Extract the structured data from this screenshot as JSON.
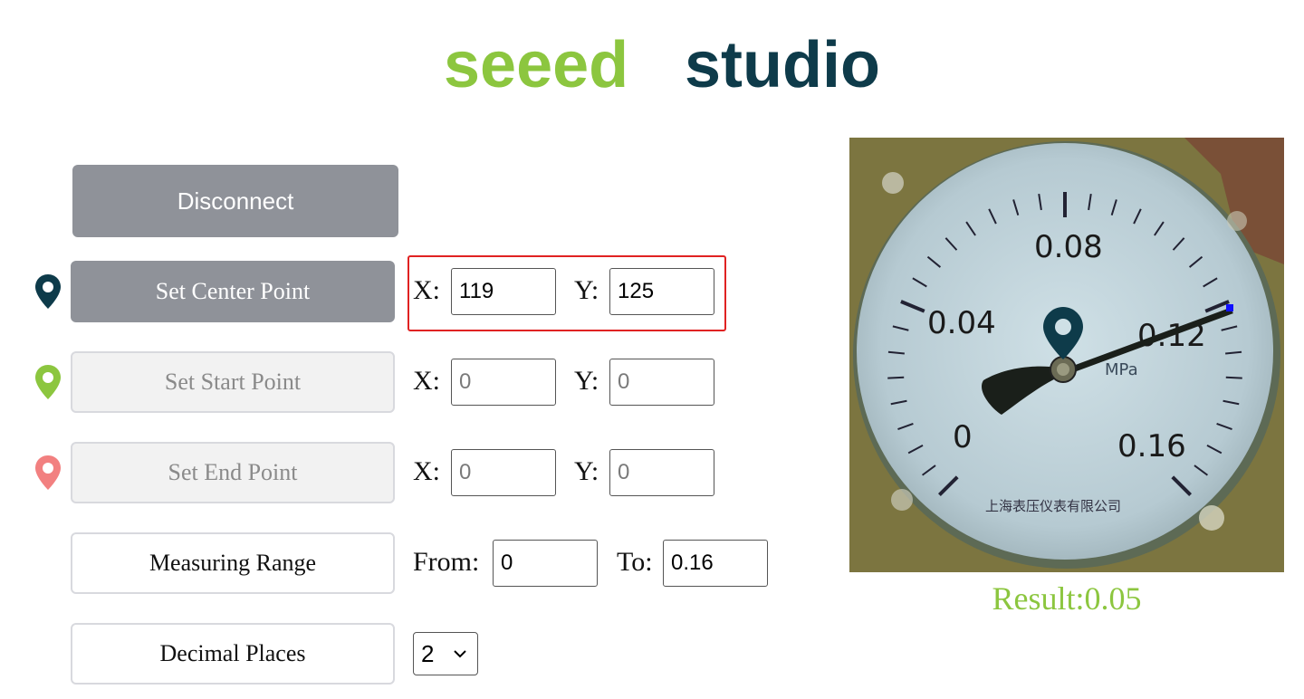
{
  "logo": {
    "word1": "seeed",
    "word2": "studio"
  },
  "buttons": {
    "disconnect": "Disconnect",
    "set_center": "Set Center Point",
    "set_start": "Set Start Point",
    "set_end": "Set End Point",
    "measuring_range": "Measuring Range",
    "decimal_places": "Decimal Places"
  },
  "labels": {
    "x": "X:",
    "y": "Y:",
    "from": "From:",
    "to": "To:"
  },
  "center": {
    "x": "119",
    "y": "125"
  },
  "start": {
    "x_placeholder": "0",
    "y_placeholder": "0"
  },
  "end": {
    "x_placeholder": "0",
    "y_placeholder": "0"
  },
  "range": {
    "from": "0",
    "to": "0.16"
  },
  "decimal": {
    "selected": "2"
  },
  "gauge": {
    "labels": [
      "0",
      "0.04",
      "0.08",
      "0.12",
      "0.16"
    ],
    "unit": "MPa",
    "maker_text": "上海表压仪表有限公司"
  },
  "result": "Result:0.05",
  "colors": {
    "brand_green": "#8cc63f",
    "brand_navy": "#0e3b4a",
    "pin_center": "#0e3b4a",
    "pin_start": "#8cc63f",
    "pin_end": "#f28080",
    "highlight": "#e02222"
  }
}
